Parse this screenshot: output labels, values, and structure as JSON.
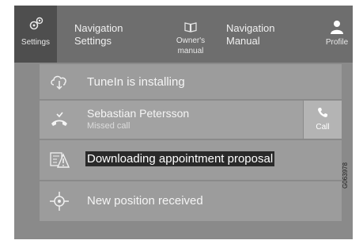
{
  "topbar": {
    "settings": {
      "icon": "gear-icon",
      "label": "Settings"
    },
    "navigation_settings": {
      "line1": "Navigation",
      "line2": "Settings"
    },
    "owners_manual": {
      "icon": "book-icon",
      "line1": "Owner's",
      "line2": "manual"
    },
    "navigation_manual": {
      "line1": "Navigation",
      "line2": "Manual"
    },
    "profile": {
      "icon": "person-icon",
      "label": "Profile"
    }
  },
  "notifications": [
    {
      "icon": "cloud-download-icon",
      "text": "TuneIn is installing"
    },
    {
      "icon": "missed-call-icon",
      "text": "Sebastian Petersson",
      "subtext": "Missed call",
      "action": {
        "icon": "phone-icon",
        "label": "Call"
      }
    },
    {
      "icon": "calendar-warning-icon",
      "text": "Downloading appointment proposal"
    },
    {
      "icon": "position-target-icon",
      "text": "New position received"
    }
  ],
  "figure_code": "G063978",
  "colors": {
    "topbar": "#6e6e6e",
    "panel": "#8a8a8a",
    "row": "#9c9c9c",
    "highlight": "#2a2a2a"
  }
}
